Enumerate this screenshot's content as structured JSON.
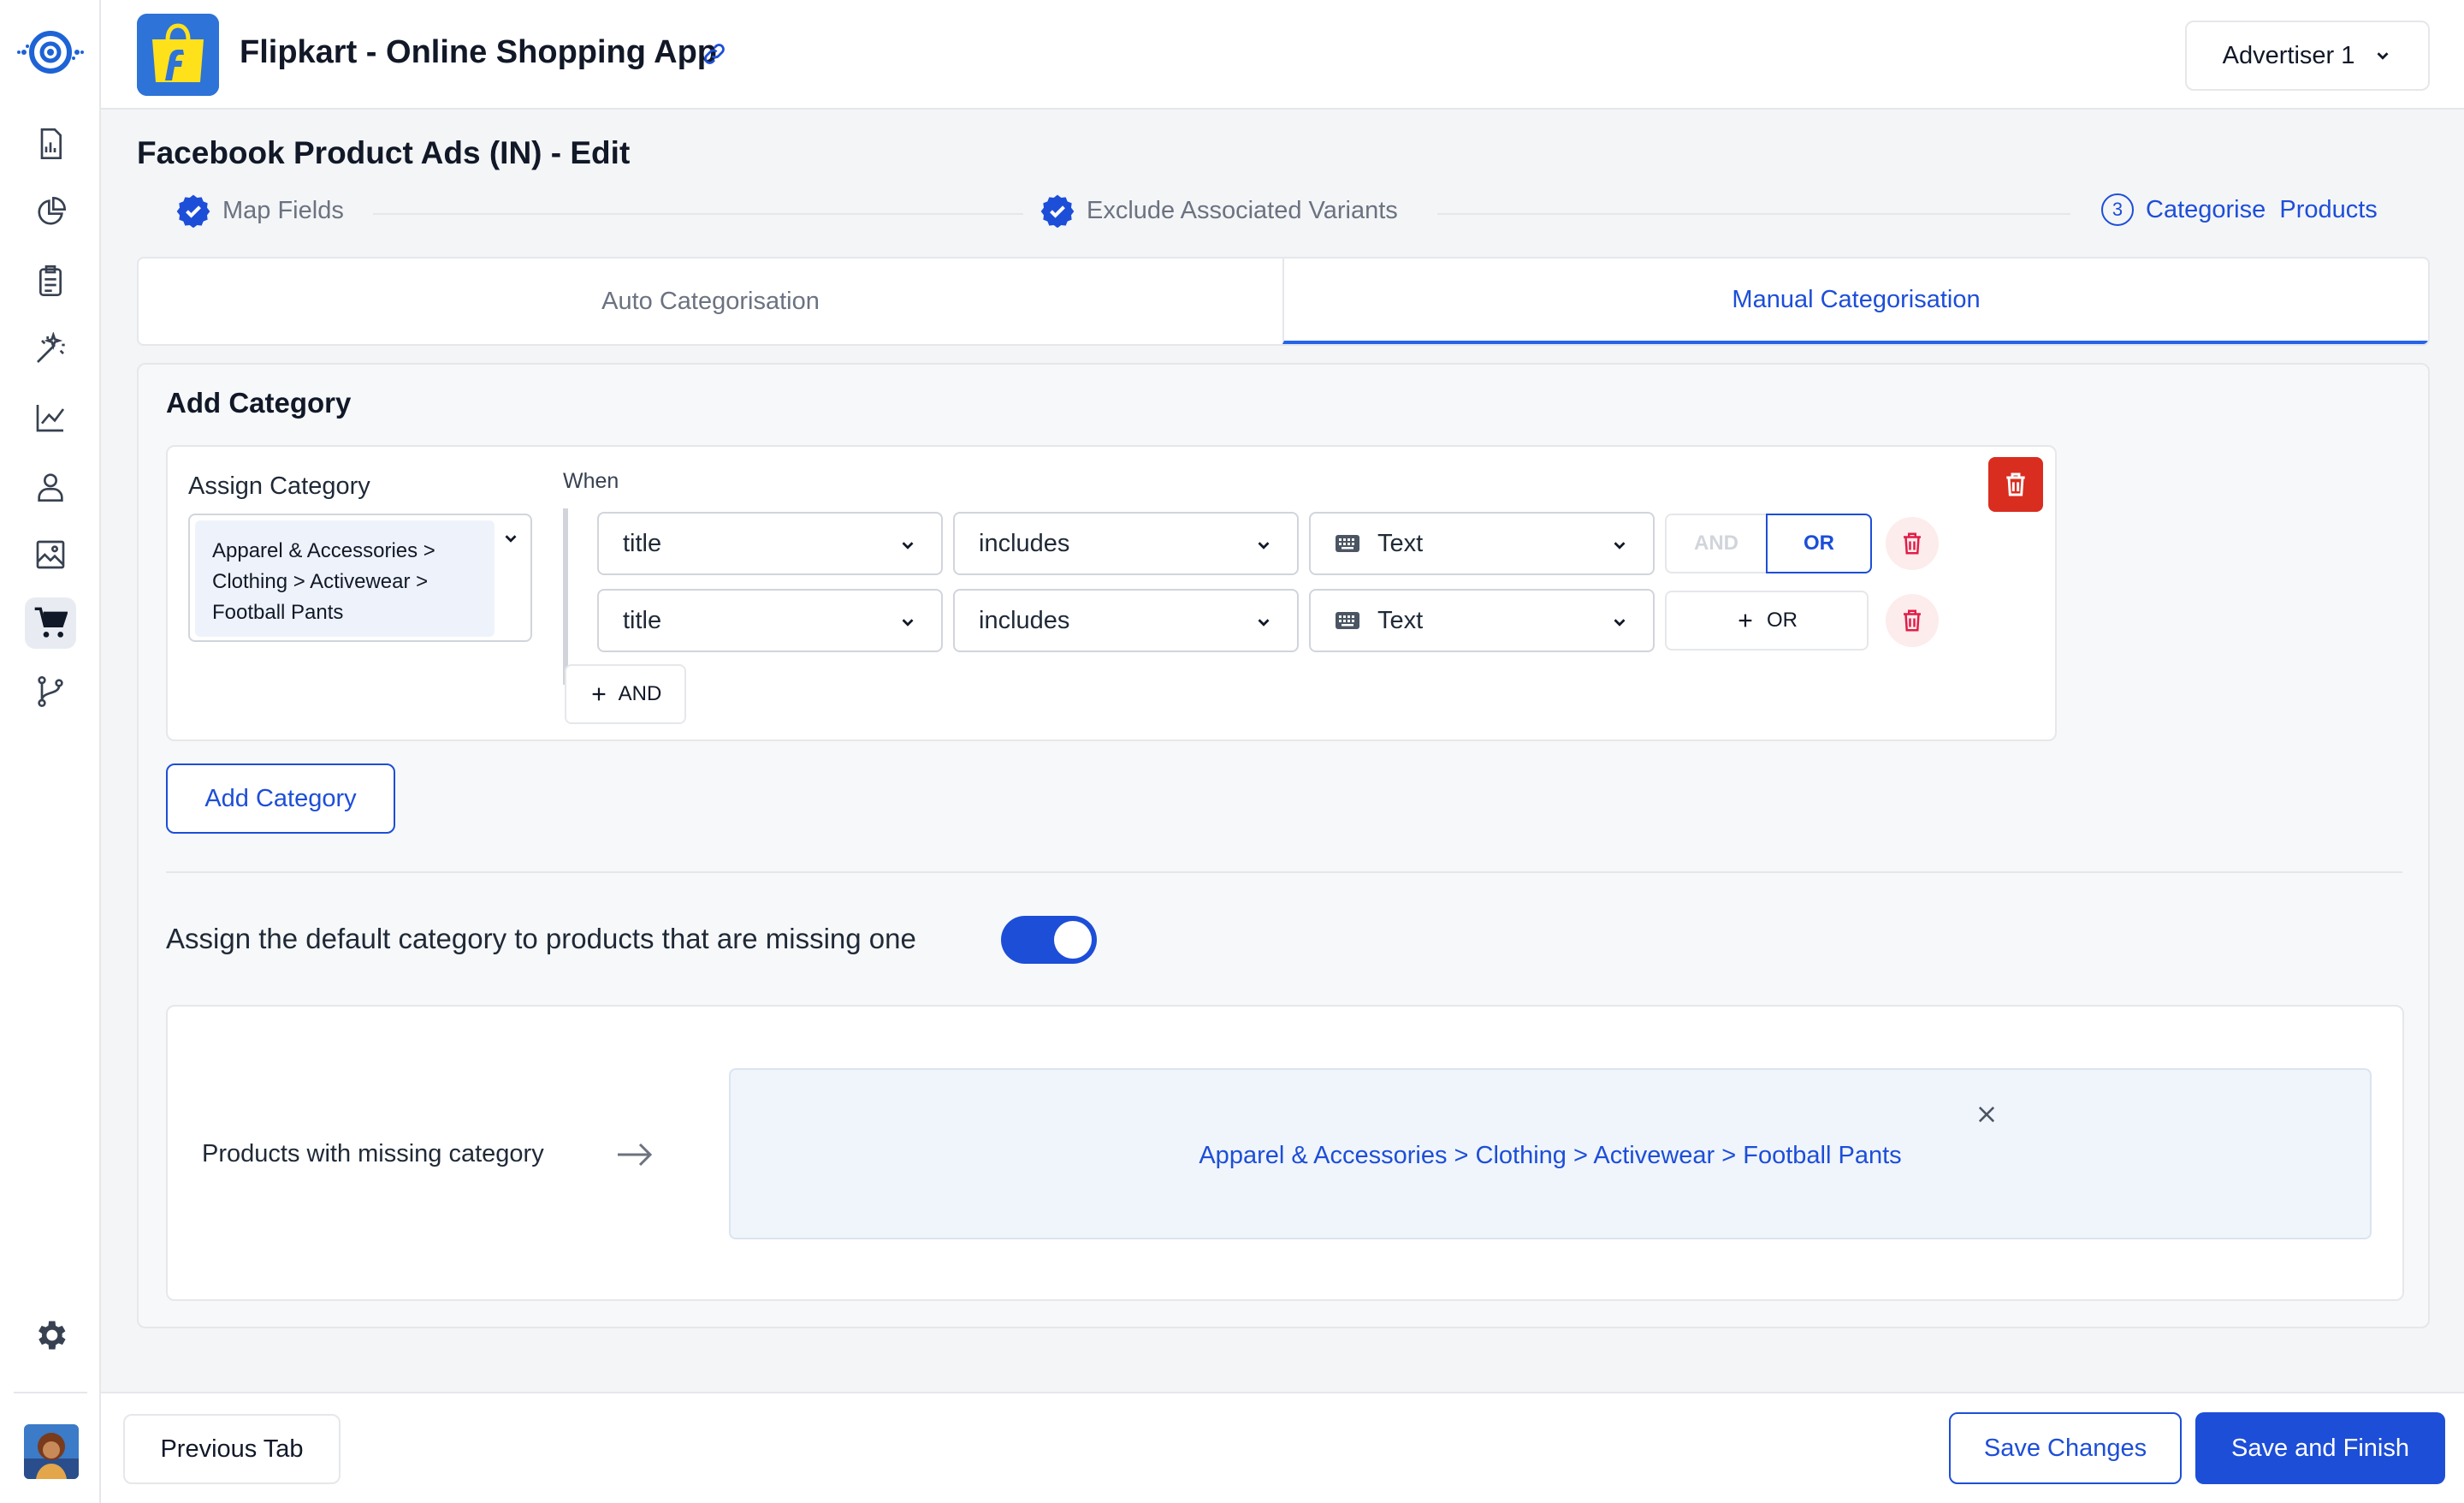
{
  "colors": {
    "primary": "#1d4ed8",
    "danger": "#d92d20",
    "background": "#f4f5f7"
  },
  "sidebar": {
    "items": [
      {
        "icon": "report-icon"
      },
      {
        "icon": "pie-chart-icon"
      },
      {
        "icon": "clipboard-icon"
      },
      {
        "icon": "magic-wand-icon"
      },
      {
        "icon": "line-chart-icon"
      },
      {
        "icon": "user-icon"
      },
      {
        "icon": "image-icon"
      },
      {
        "icon": "cart-icon",
        "active": true
      },
      {
        "icon": "branch-icon"
      }
    ],
    "settings_icon": "gear-icon"
  },
  "header": {
    "app_title": "Flipkart - Online Shopping App",
    "advertiser": "Advertiser 1"
  },
  "page": {
    "title": "Facebook Product Ads (IN) - Edit",
    "steps": [
      {
        "label": "Map Fields",
        "status": "done"
      },
      {
        "label": "Exclude Associated Variants",
        "status": "done"
      },
      {
        "number": "3",
        "label": "Categorise  Products",
        "status": "active"
      }
    ],
    "tabs": [
      {
        "label": "Auto Categorisation",
        "active": false
      },
      {
        "label": "Manual Categorisation",
        "active": true
      }
    ]
  },
  "panel": {
    "title": "Add Category",
    "rule": {
      "assign_label": "Assign Category",
      "assigned_category": "Apparel & Accessories > Clothing > Activewear > Football Pants",
      "when_label": "When",
      "conditions": [
        {
          "field": "title",
          "operator": "includes",
          "value": "Text",
          "and_label": "AND",
          "or_label": "OR"
        },
        {
          "field": "title",
          "operator": "includes",
          "value": "Text",
          "add_or_label": "OR"
        }
      ],
      "add_and_label": "AND"
    },
    "add_category_button": "Add Category",
    "default_toggle": {
      "label": "Assign the default category to products that are missing one",
      "enabled": true
    },
    "missing": {
      "label": "Products with missing category",
      "category": "Apparel & Accessories > Clothing > Activewear > Football Pants"
    }
  },
  "footer": {
    "previous": "Previous Tab",
    "save": "Save Changes",
    "finish": "Save and Finish"
  }
}
